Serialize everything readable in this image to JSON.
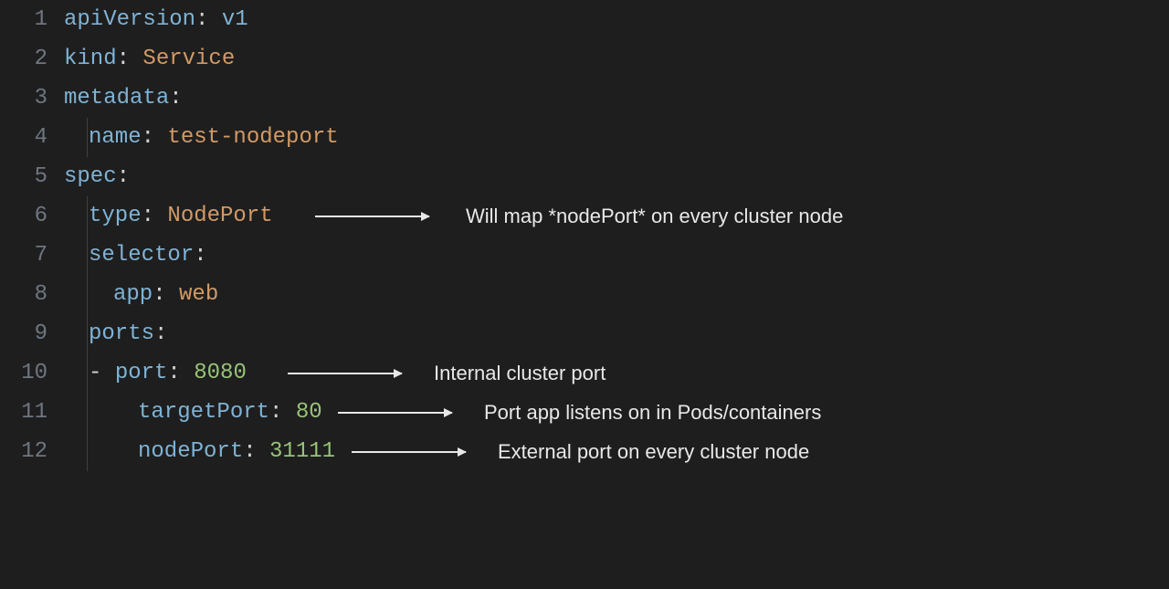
{
  "lineNumbers": [
    "1",
    "2",
    "3",
    "4",
    "5",
    "6",
    "7",
    "8",
    "9",
    "10",
    "11",
    "12"
  ],
  "yaml": {
    "l1": {
      "k": "apiVersion",
      "v": "v1"
    },
    "l2": {
      "k": "kind",
      "v": "Service"
    },
    "l3": {
      "k": "metadata"
    },
    "l4": {
      "k": "name",
      "v": "test-nodeport"
    },
    "l5": {
      "k": "spec"
    },
    "l6": {
      "k": "type",
      "v": "NodePort"
    },
    "l7": {
      "k": "selector"
    },
    "l8": {
      "k": "app",
      "v": "web"
    },
    "l9": {
      "k": "ports"
    },
    "l10": {
      "dash": "- ",
      "k": "port",
      "v": "8080"
    },
    "l11": {
      "k": "targetPort",
      "v": "80"
    },
    "l12": {
      "k": "nodePort",
      "v": "31111"
    }
  },
  "annotations": {
    "a1": "Will map *nodePort* on every cluster node",
    "a2": "Internal cluster port",
    "a3": "Port app listens on in Pods/containers",
    "a4": "External port on every cluster node"
  },
  "colon": ":",
  "sp": " "
}
